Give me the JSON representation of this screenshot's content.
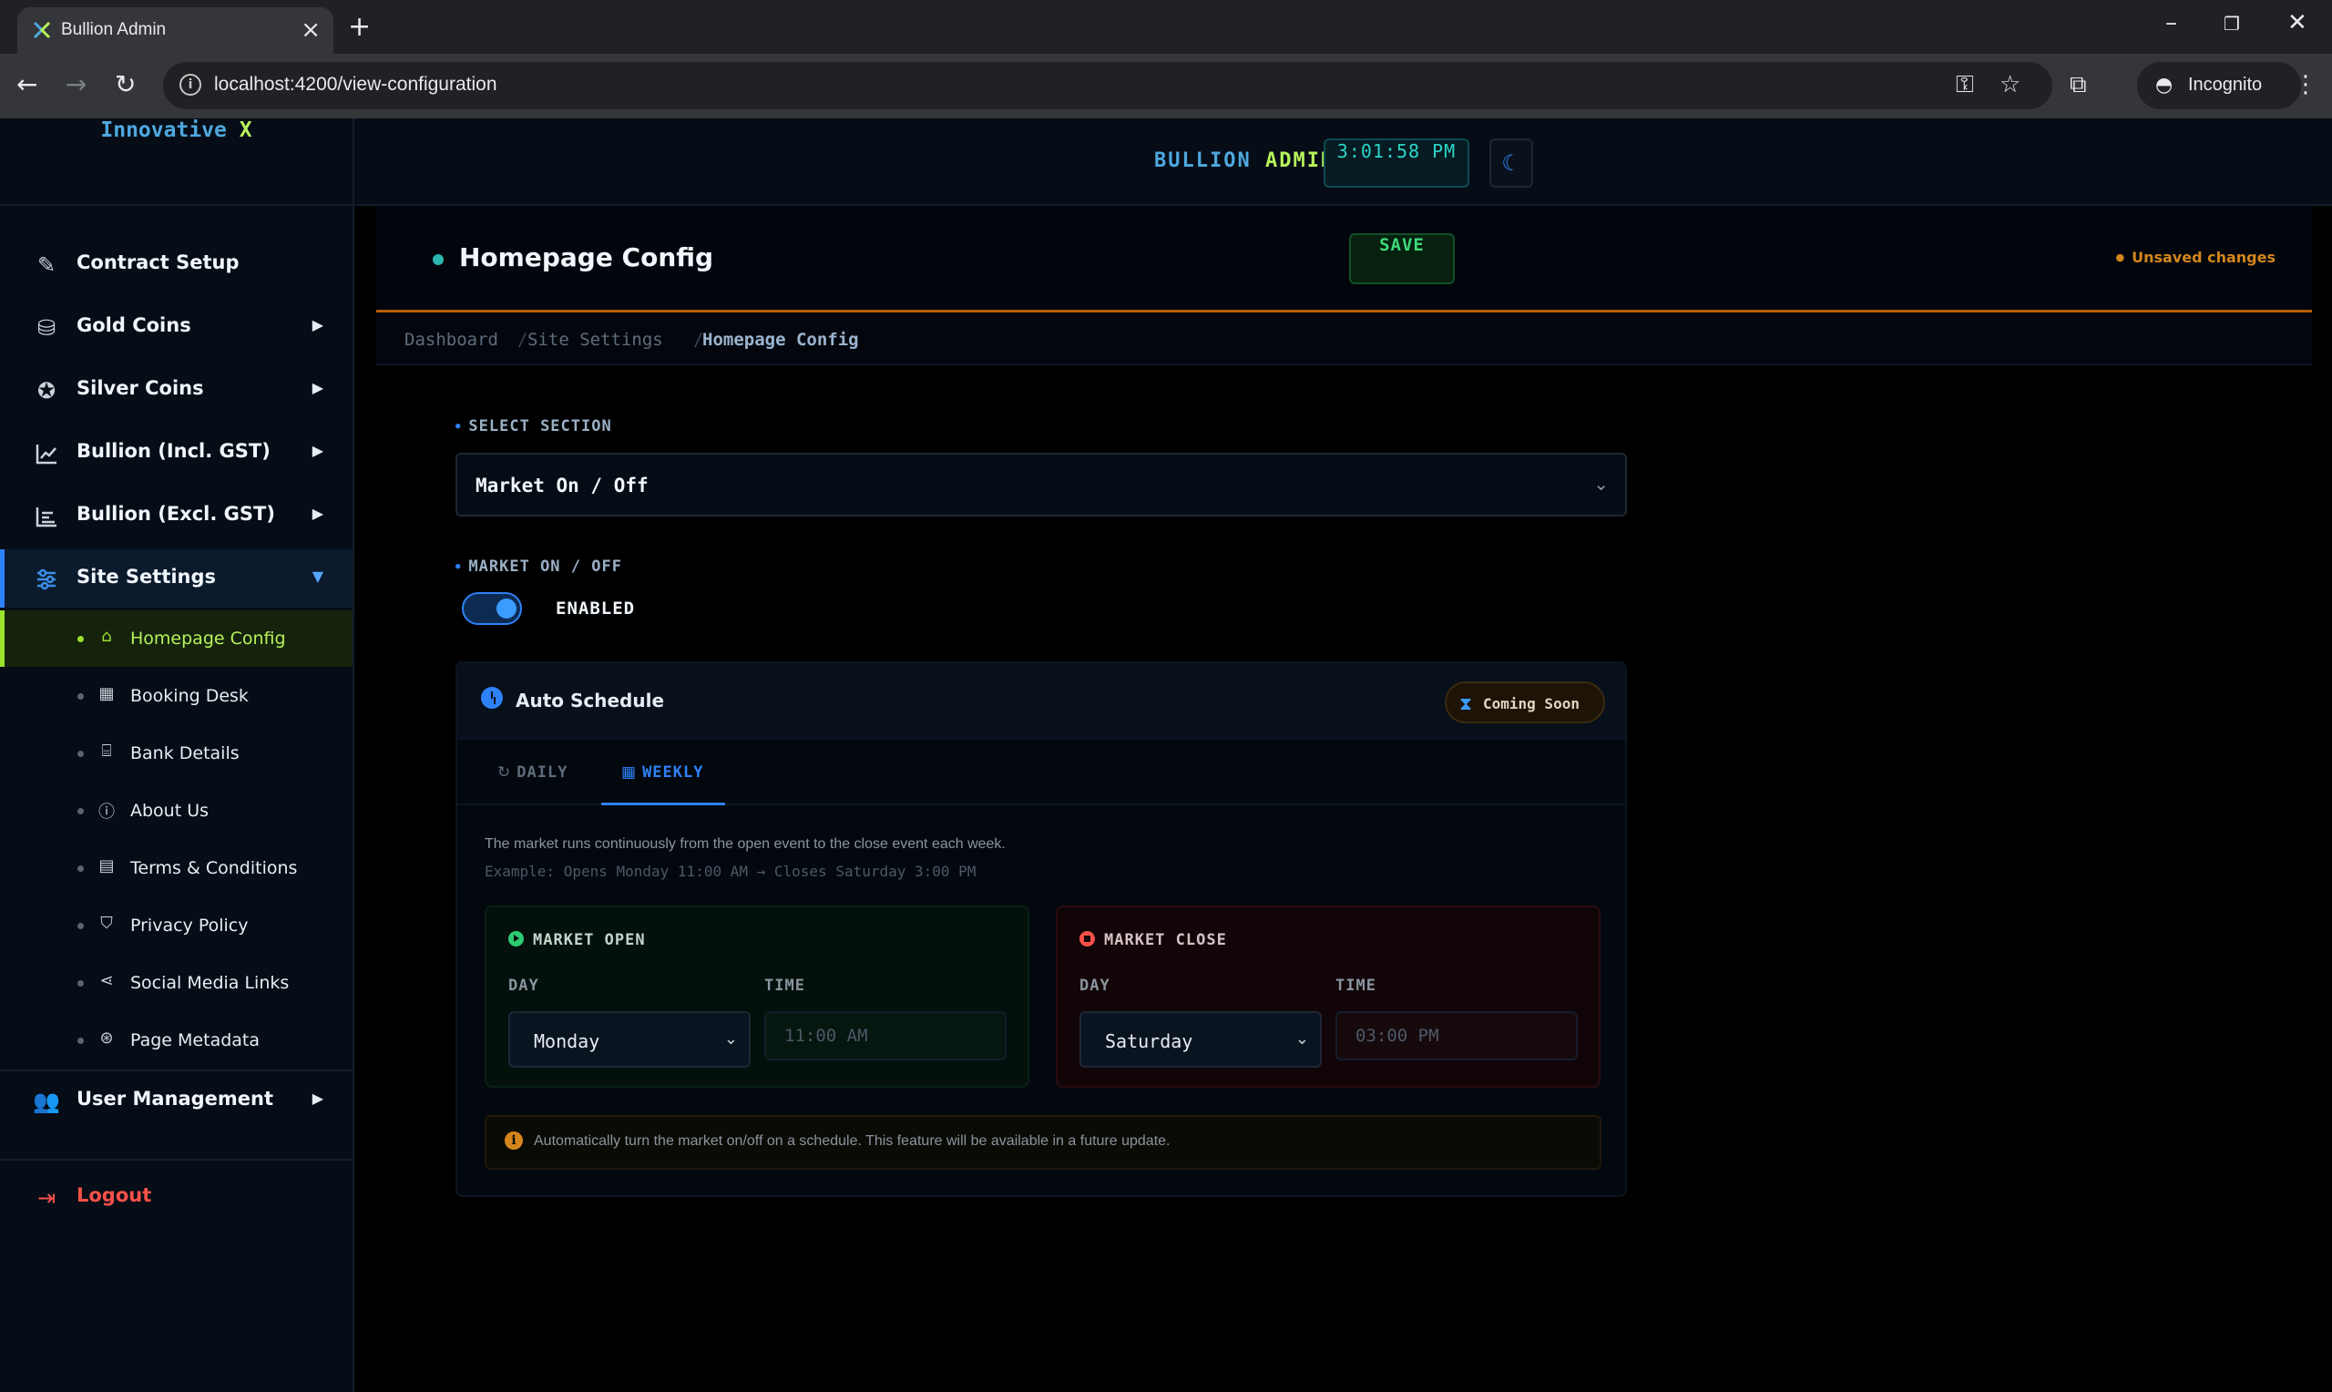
{
  "browser": {
    "tab_title": "Bullion Admin",
    "url": "localhost:4200/view-configuration",
    "incognito_label": "Incognito"
  },
  "brand": {
    "part1": "Innovative",
    "part2": "X"
  },
  "header": {
    "title_part1": "BULLION",
    "title_part2": "ADMIN",
    "clock": "3:01:58 PM"
  },
  "sidebar": {
    "items": [
      {
        "label": "Contract Setup",
        "icon": "file-signature-icon"
      },
      {
        "label": "Gold Coins",
        "icon": "coins-icon"
      },
      {
        "label": "Silver Coins",
        "icon": "medal-icon"
      },
      {
        "label": "Bullion (Incl. GST)",
        "icon": "chart-line-icon"
      },
      {
        "label": "Bullion (Excl. GST)",
        "icon": "chart-bar-icon"
      },
      {
        "label": "Site Settings",
        "icon": "sliders-icon"
      }
    ],
    "sub_items": [
      {
        "label": "Homepage Config",
        "icon": "home-icon"
      },
      {
        "label": "Booking Desk",
        "icon": "calendar-icon"
      },
      {
        "label": "Bank Details",
        "icon": "bank-icon"
      },
      {
        "label": "About Us",
        "icon": "info-icon"
      },
      {
        "label": "Terms & Conditions",
        "icon": "file-icon"
      },
      {
        "label": "Privacy Policy",
        "icon": "shield-icon"
      },
      {
        "label": "Social Media Links",
        "icon": "share-icon"
      },
      {
        "label": "Page Metadata",
        "icon": "tags-icon"
      }
    ],
    "user_management": "User Management",
    "logout": "Logout"
  },
  "page": {
    "title": "Homepage Config",
    "save_label": "SAVE",
    "unsaved": "Unsaved changes",
    "breadcrumb": [
      "Dashboard",
      "Site Settings",
      "Homepage Config"
    ]
  },
  "form": {
    "select_section_label": "SELECT SECTION",
    "select_section_value": "Market On / Off",
    "market_label": "MARKET ON / OFF",
    "toggle_on": true,
    "toggle_label": "ENABLED"
  },
  "schedule": {
    "title": "Auto Schedule",
    "badge": "Coming Soon",
    "tabs": [
      "DAILY",
      "WEEKLY"
    ],
    "active_tab": "WEEKLY",
    "description": "The market runs continuously from the open event to the close event each week.",
    "example": "Example: Opens Monday 11:00 AM → Closes Saturday 3:00 PM",
    "open": {
      "title": "MARKET OPEN",
      "day_label": "DAY",
      "time_label": "TIME",
      "day": "Monday",
      "time": "11:00 AM"
    },
    "close": {
      "title": "MARKET CLOSE",
      "day_label": "DAY",
      "time_label": "TIME",
      "day": "Saturday",
      "time": "03:00 PM"
    },
    "note": "Automatically turn the market on/off on a schedule. This feature will be available in a future update."
  },
  "colors": {
    "accent_blue": "#2f81f7",
    "accent_green": "#9be22d",
    "warning_orange": "#d4861c",
    "danger_red": "#f85149"
  }
}
